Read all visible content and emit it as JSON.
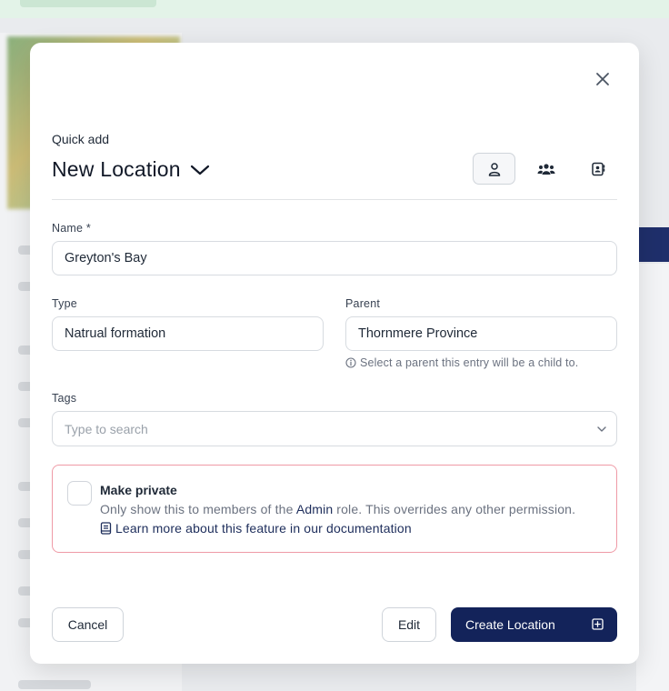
{
  "modal": {
    "subtitle": "Quick add",
    "title": "New Location"
  },
  "fields": {
    "name": {
      "label": "Name *",
      "value": "Greyton's Bay"
    },
    "type": {
      "label": "Type",
      "value": "Natrual formation"
    },
    "parent": {
      "label": "Parent",
      "value": "Thornmere Province",
      "help": "Select a parent this entry will be a child to."
    },
    "tags": {
      "label": "Tags",
      "placeholder": "Type to search"
    }
  },
  "privacy": {
    "title": "Make private",
    "desc_before": "Only show this to members of the ",
    "desc_role": "Admin",
    "desc_after": " role. This overrides any other permission.",
    "link": "Learn more about this feature in our documentation"
  },
  "footer": {
    "cancel": "Cancel",
    "edit": "Edit",
    "create": "Create Location"
  },
  "icons": {
    "close": "close-icon",
    "chevron": "chevron-down-icon",
    "entities": [
      "user-icon",
      "users-icon",
      "contact-card-icon"
    ],
    "info": "info-icon",
    "book": "book-icon",
    "plus": "plus-square-icon"
  },
  "colors": {
    "primary": "#13235a",
    "danger_border": "#ef9aa6",
    "link": "#1d2d5b"
  }
}
